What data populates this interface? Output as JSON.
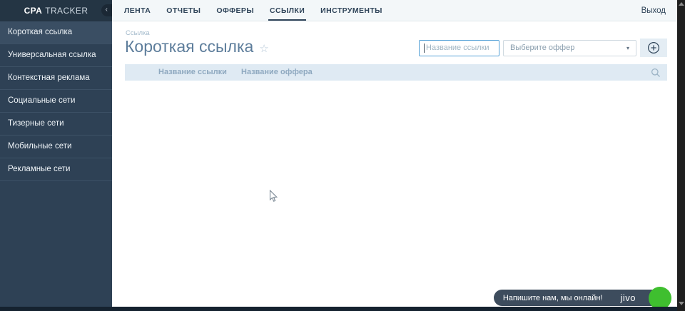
{
  "brand": {
    "bold": "CPA",
    "rest": "TRACKER"
  },
  "sidebar": {
    "collapse_icon": "‹",
    "active_item": "Короткая ссылка",
    "items": [
      {
        "label": "Короткая ссылка"
      },
      {
        "label": "Универсальная ссылка"
      },
      {
        "label": "Контекстная реклама"
      },
      {
        "label": "Социальные сети"
      },
      {
        "label": "Тизерные сети"
      },
      {
        "label": "Мобильные сети"
      },
      {
        "label": "Рекламные сети"
      }
    ]
  },
  "topnav": {
    "tabs": [
      {
        "label": "ЛЕНТА"
      },
      {
        "label": "ОТЧЕТЫ"
      },
      {
        "label": "ОФФЕРЫ"
      },
      {
        "label": "ССЫЛКИ"
      },
      {
        "label": "ИНСТРУМЕНТЫ"
      }
    ],
    "active_tab": "ССЫЛКИ",
    "logout": "Выход"
  },
  "page": {
    "breadcrumb": "Ссылка",
    "title": "Короткая ссылка",
    "favorite_icon": "☆"
  },
  "filters": {
    "link_name_placeholder": "Название ссылки",
    "offer_placeholder": "Выберите оффер",
    "caret_icon": "▼"
  },
  "table": {
    "columns": [
      "Название ссылки",
      "Название оффера"
    ],
    "rows": []
  },
  "chat": {
    "message": "Напишите нам, мы онлайн!",
    "brand": "jivo"
  },
  "colors": {
    "sidebar_bg": "#2e4155",
    "sidebar_header_bg": "#243544",
    "sidebar_active_bg": "#3a4e63",
    "topnav_bg": "#f3f7f9",
    "nav_text": "#2f4459",
    "table_header_bg": "#dfeaf3",
    "table_header_text": "#8fa9c0",
    "title_text": "#5d7d9b",
    "focus_border": "#55a1d6",
    "chat_bg": "#3d4c5d",
    "chat_online_green": "#3fbf2f"
  }
}
